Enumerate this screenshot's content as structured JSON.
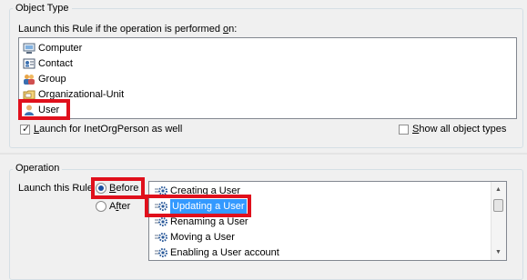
{
  "object_type": {
    "legend": "Object Type",
    "prompt": "Launch this Rule if the operation is performed on:",
    "items": [
      {
        "label": "Computer",
        "icon": "computer-icon"
      },
      {
        "label": "Contact",
        "icon": "contact-card-icon"
      },
      {
        "label": "Group",
        "icon": "group-icon"
      },
      {
        "label": "Organizational-Unit",
        "icon": "organizational-unit-icon"
      },
      {
        "label": "User",
        "icon": "user-icon"
      }
    ],
    "highlighted_item": "User",
    "launch_inetorgperson": {
      "label": "Launch for InetOrgPerson as well",
      "checked": true
    },
    "show_all_object_types": {
      "label": "Show all object types",
      "checked": false
    }
  },
  "operation": {
    "legend": "Operation",
    "launch_label": "Launch this Rule",
    "timing_options": [
      {
        "label": "Before",
        "selected": true
      },
      {
        "label": "After",
        "selected": false
      }
    ],
    "operations": [
      {
        "label": "Creating a User",
        "selected": false
      },
      {
        "label": "Updating a User",
        "selected": true
      },
      {
        "label": "Renaming a User",
        "selected": false
      },
      {
        "label": "Moving a User",
        "selected": false
      },
      {
        "label": "Enabling a User account",
        "selected": false
      }
    ],
    "scroll_up": "▲",
    "scroll_down": "▼"
  },
  "colors": {
    "highlight_box": "#e0101c",
    "selection": "#3399ff",
    "window_background": "#f0f0f0"
  }
}
